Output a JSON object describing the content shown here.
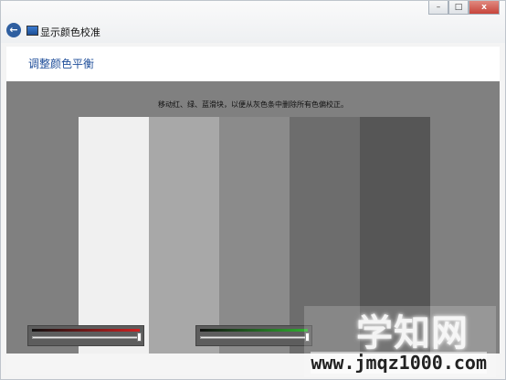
{
  "window": {
    "title": "显示颜色校准",
    "controls": {
      "minimize": "–",
      "maximize": "□",
      "close": "x"
    }
  },
  "header": {
    "title": "调整颜色平衡"
  },
  "content": {
    "instruction": "移动红、绿、蓝滑块，以便从灰色条中删除所有色偏校正。",
    "gray_bars": [
      "#f0f0f0",
      "#a8a8a8",
      "#8b8b8b",
      "#6d6d6d",
      "#565656"
    ],
    "sliders": [
      {
        "name": "red",
        "color": "#d02020",
        "value": 1.0
      },
      {
        "name": "green",
        "color": "#30b030",
        "value": 1.0
      }
    ]
  },
  "watermark": {
    "main": "学知网",
    "sub": "www.jmqz1000.com"
  }
}
